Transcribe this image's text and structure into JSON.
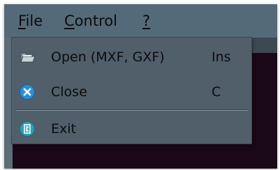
{
  "menubar": {
    "file": {
      "label": "File",
      "mnemonic": "F",
      "rest": "ile"
    },
    "control": {
      "label": "Control",
      "mnemonic": "C",
      "rest": "ontrol"
    },
    "help": {
      "label": "?",
      "mnemonic": "?",
      "rest": ""
    }
  },
  "file_menu": {
    "items": [
      {
        "label": "Open (MXF, GXF)",
        "shortcut": "Ins",
        "icon": "open-folder-icon"
      },
      {
        "label": "Close",
        "shortcut": "C",
        "icon": "close-x-icon"
      },
      {
        "label": "Exit",
        "shortcut": "",
        "icon": "exit-door-icon"
      }
    ]
  },
  "colors": {
    "menubar_bg": "#556a79",
    "dropdown_bg": "#515f6b",
    "text": "#0b0b0b",
    "dark_panel": "#1a0717",
    "close_icon_blue": "#2a8fd6",
    "exit_icon_teal": "#2d9fb3"
  }
}
